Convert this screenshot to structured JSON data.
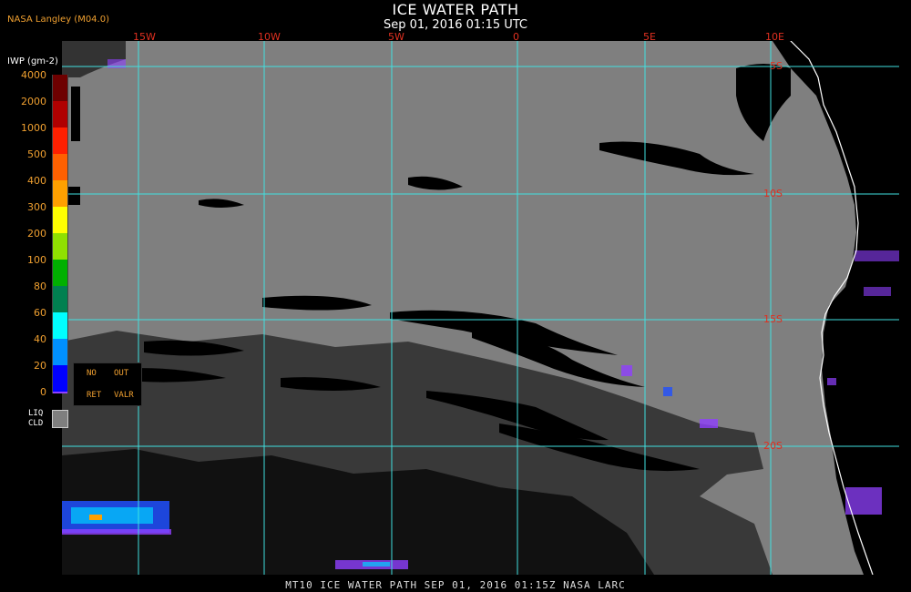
{
  "title": "ICE WATER PATH",
  "timestamp": "Sep 01, 2016 01:15 UTC",
  "source": "NASA Langley (M04.0)",
  "legend": {
    "unit_label": "IWP (gm-2)",
    "scale": [
      {
        "value": "4000",
        "color": "#6e0000"
      },
      {
        "value": "2000",
        "color": "#b00000"
      },
      {
        "value": "1000",
        "color": "#ff2000"
      },
      {
        "value": "500",
        "color": "#ff6000"
      },
      {
        "value": "400",
        "color": "#ffa000"
      },
      {
        "value": "300",
        "color": "#ffff00"
      },
      {
        "value": "200",
        "color": "#90e000"
      },
      {
        "value": "100",
        "color": "#00b000"
      },
      {
        "value": "80",
        "color": "#008050"
      },
      {
        "value": "60",
        "color": "#00ffff"
      },
      {
        "value": "40",
        "color": "#0090ff"
      },
      {
        "value": "20",
        "color": "#0000ff"
      },
      {
        "value": "0",
        "color": "#9040ff"
      }
    ],
    "no_ret": [
      "NO",
      "RET"
    ],
    "out_valr": [
      "OUT",
      "VALR"
    ],
    "liq_label": [
      "LIQ",
      "CLD"
    ]
  },
  "map": {
    "longitude_labels": [
      "15W",
      "10W",
      "5W",
      "0",
      "5E",
      "10E"
    ],
    "latitude_labels": [
      "5S",
      "10S",
      "15S",
      "20S"
    ],
    "grid_color": "#40e0e0",
    "ocean_color": "#7f7f7f",
    "clear_color": "#000000",
    "coast_color": "#ffffff"
  },
  "footer": "MT10  ICE WATER PATH   SEP 01, 2016 01:15Z   NASA LARC"
}
